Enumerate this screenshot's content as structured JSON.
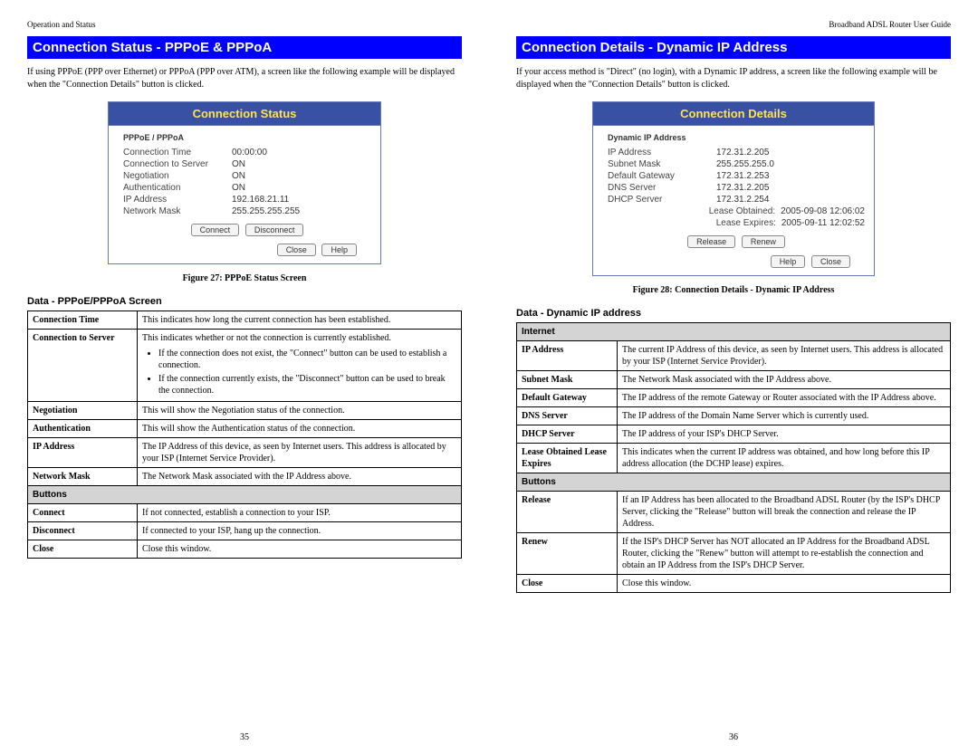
{
  "left": {
    "header": "Operation and Status",
    "title": "Connection Status - PPPoE & PPPoA",
    "intro": "If using PPPoE (PPP over Ethernet) or PPPoA (PPP over ATM), a screen like the following example will be displayed when the \"Connection Details\" button is clicked.",
    "panel_title": "Connection Status",
    "panel_sub": "PPPoE / PPPoA",
    "rows": {
      "r0k": "Connection Time",
      "r0v": "00:00:00",
      "r1k": "Connection to Server",
      "r1v": "ON",
      "r2k": "Negotiation",
      "r2v": "ON",
      "r3k": "Authentication",
      "r3v": "ON",
      "r4k": "IP Address",
      "r4v": "192.168.21.11",
      "r5k": "Network Mask",
      "r5v": "255.255.255.255"
    },
    "btn_connect": "Connect",
    "btn_disconnect": "Disconnect",
    "btn_close": "Close",
    "btn_help": "Help",
    "figcap": "Figure 27: PPPoE Status Screen",
    "data_head": "Data - PPPoE/PPPoA Screen",
    "tbl": {
      "r0a": "Connection Time",
      "r0b": "This indicates how long the current connection has been established.",
      "r1a": "Connection to Server",
      "r1b": "This indicates whether or not the connection is currently established.",
      "r1li1": "If the connection does not exist, the \"Connect\" button can be used to establish a connection.",
      "r1li2": "If the connection currently exists, the \"Disconnect\" button can be used to break the connection.",
      "r2a": "Negotiation",
      "r2b": "This will show the Negotiation status of the connection.",
      "r3a": "Authentication",
      "r3b": "This will show the Authentication status of the connection.",
      "r4a": "IP Address",
      "r4b": "The IP Address of this device, as seen by Internet users. This address is allocated by your ISP (Internet Service Provider).",
      "r5a": "Network Mask",
      "r5b": "The Network Mask associated with the IP Address above.",
      "sect": "Buttons",
      "r6a": "Connect",
      "r6b": "If not connected, establish a connection to your ISP.",
      "r7a": "Disconnect",
      "r7b": "If connected to your ISP, hang up the connection.",
      "r8a": "Close",
      "r8b": "Close this window."
    },
    "pagenum": "35"
  },
  "right": {
    "header": "Broadband ADSL Router User Guide",
    "title": "Connection Details - Dynamic IP Address",
    "intro": "If your access method is \"Direct\" (no login), with a Dynamic IP address, a screen like the following example will be displayed when the \"Connection Details\" button is clicked.",
    "panel_title": "Connection Details",
    "panel_sub": "Dynamic IP Address",
    "rows": {
      "r0k": "IP Address",
      "r0v": "172.31.2.205",
      "r1k": "Subnet Mask",
      "r1v": "255.255.255.0",
      "r2k": "Default Gateway",
      "r2v": "172.31.2.253",
      "r3k": "DNS Server",
      "r3v": "172.31.2.205",
      "r4k": "DHCP Server",
      "r4v": "172.31.2.254",
      "r5k": "Lease Obtained:",
      "r5v": "2005-09-08 12:06:02",
      "r6k": "Lease Expires:",
      "r6v": "2005-09-11 12:02:52"
    },
    "btn_release": "Release",
    "btn_renew": "Renew",
    "btn_help": "Help",
    "btn_close": "Close",
    "figcap": "Figure 28: Connection Details - Dynamic IP Address",
    "data_head": "Data - Dynamic IP address",
    "tbl": {
      "sect1": "Internet",
      "r0a": "IP Address",
      "r0b": "The current IP Address of this device, as seen by Internet users. This address is allocated by your ISP (Internet Service Provider).",
      "r1a": "Subnet Mask",
      "r1b": "The Network Mask associated with the IP Address above.",
      "r2a": "Default Gateway",
      "r2b": "The IP address of the remote Gateway or Router associated with the IP Address above.",
      "r3a": "DNS Server",
      "r3b": "The IP address of the Domain Name Server which is currently used.",
      "r4a": "DHCP Server",
      "r4b": "The IP address of your ISP's DHCP Server.",
      "r5a": "Lease Obtained Lease Expires",
      "r5b": "This indicates when the current IP address was obtained, and how long before this IP address allocation (the DCHP lease) expires.",
      "sect2": "Buttons",
      "r6a": "Release",
      "r6b": "If an IP Address has been allocated to the Broadband ADSL Router (by the ISP's DHCP Server, clicking the \"Release\" button will break the connection and release the IP Address.",
      "r7a": "Renew",
      "r7b": "If the ISP's DHCP Server has NOT allocated an IP Address for the Broadband ADSL Router, clicking the \"Renew\" button will attempt to re-establish the connection and obtain an IP Address from the ISP's DHCP Server.",
      "r8a": "Close",
      "r8b": "Close this window."
    },
    "pagenum": "36"
  }
}
